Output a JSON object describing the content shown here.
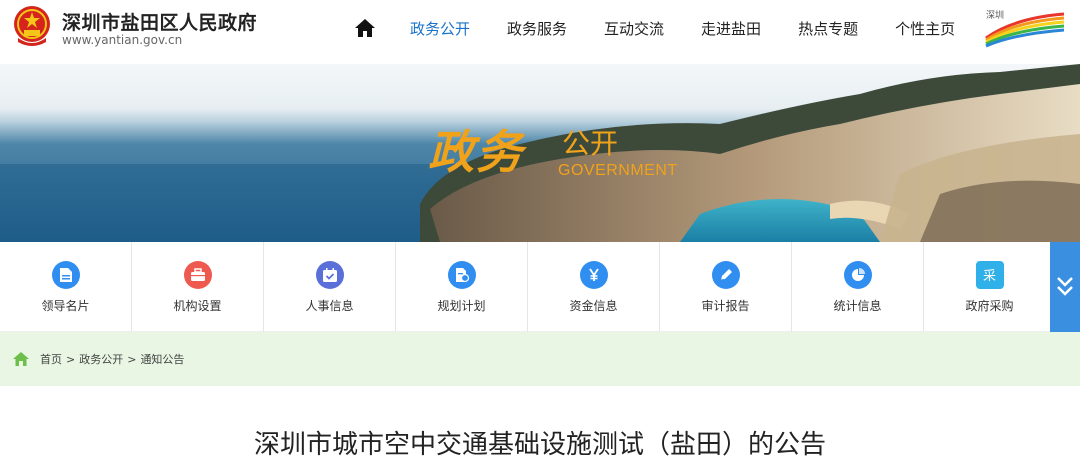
{
  "header": {
    "site_title": "深圳市盐田区人民政府",
    "site_url": "www.yantian.gov.cn",
    "brand_logo_text": "深圳 SHENZHEN CHINA"
  },
  "nav": {
    "items": [
      {
        "label": "政务公开",
        "active": true
      },
      {
        "label": "政务服务",
        "active": false
      },
      {
        "label": "互动交流",
        "active": false
      },
      {
        "label": "走进盐田",
        "active": false
      },
      {
        "label": "热点专题",
        "active": false
      },
      {
        "label": "个性主页",
        "active": false
      }
    ],
    "active_color": "#1a73c8"
  },
  "banner": {
    "title_calligraphy": "政务",
    "title_plain": "公开",
    "subtitle": "GOVERNMENT",
    "accent": "#f0a21b"
  },
  "quick_links": {
    "items": [
      {
        "label": "领导名片",
        "icon": "document-icon",
        "color": "#2f8ef0"
      },
      {
        "label": "机构设置",
        "icon": "briefcase-icon",
        "color": "#ee5a4f"
      },
      {
        "label": "人事信息",
        "icon": "calendar-check-icon",
        "color": "#5b6fd9"
      },
      {
        "label": "规划计划",
        "icon": "document-gear-icon",
        "color": "#2f8ef0"
      },
      {
        "label": "资金信息",
        "icon": "yuan-icon",
        "color": "#2f8ef0"
      },
      {
        "label": "审计报告",
        "icon": "pen-icon",
        "color": "#2f8ef0"
      },
      {
        "label": "统计信息",
        "icon": "pie-chart-icon",
        "color": "#2f8ef0"
      },
      {
        "label": "政府采购",
        "icon": "purchase-icon",
        "color": "#2fb0e8",
        "glyph": "采"
      }
    ]
  },
  "breadcrumb": {
    "items": [
      "首页",
      "政务公开",
      "通知公告"
    ],
    "separator": ">"
  },
  "article": {
    "title": "深圳市城市空中交通基础设施测试（盐田）的公告"
  }
}
